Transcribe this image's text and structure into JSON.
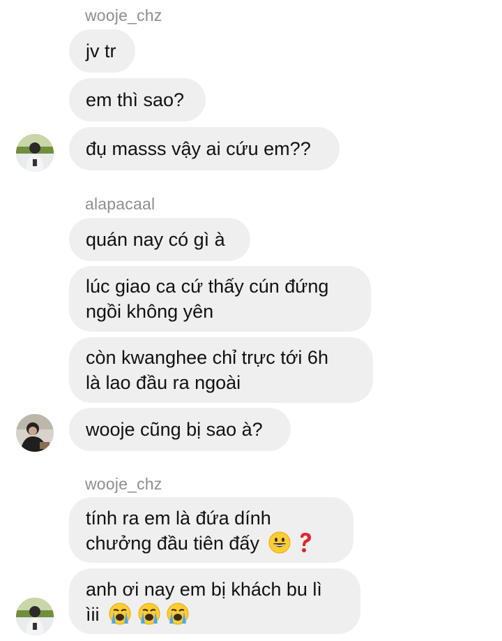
{
  "conversation": {
    "groups": [
      {
        "sender": "wooje_chz",
        "messages": [
          {
            "lines": [
              "jv tr"
            ]
          },
          {
            "lines": [
              "em thì sao?"
            ]
          },
          {
            "lines": [
              "đụ masss vậy ai cứu em??"
            ]
          }
        ],
        "avatar": "stadium-player-avatar"
      },
      {
        "sender": "alapacaal",
        "messages": [
          {
            "lines": [
              "quán nay có gì à"
            ]
          },
          {
            "lines": [
              "lúc giao ca cứ thấy cún đứng",
              "ngồi không yên"
            ]
          },
          {
            "lines": [
              "còn kwanghee chỉ trực tới 6h",
              "là lao đầu ra ngoài"
            ]
          },
          {
            "lines": [
              "wooje cũng bị sao à?"
            ]
          }
        ],
        "avatar": "dark-portrait-avatar"
      },
      {
        "sender": "wooje_chz",
        "messages": [
          {
            "lines": [
              "tính ra em là đứa dính",
              "chưởng đầu tiên đấy"
            ],
            "trailing_emoji": [
              "grinning-face-emoji",
              "red-question-mark-emoji"
            ]
          },
          {
            "lines": [
              "anh ơi nay em bị khách bu lì",
              "ìii"
            ],
            "trailing_emoji": [
              "loudly-crying-face-emoji",
              "loudly-crying-face-emoji",
              "loudly-crying-face-emoji"
            ]
          }
        ],
        "avatar": "stadium-player-avatar"
      }
    ]
  }
}
